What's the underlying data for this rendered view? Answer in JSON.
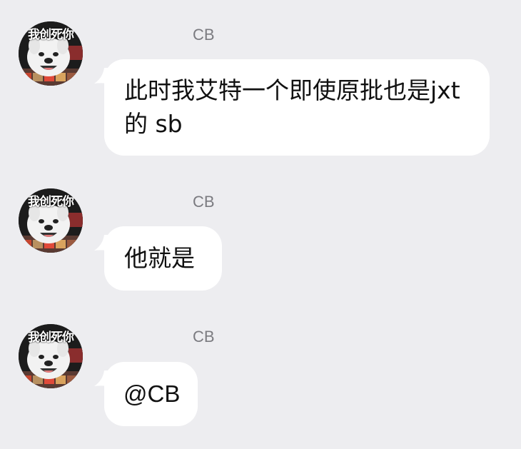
{
  "messages": [
    {
      "sender": "CB",
      "avatar_caption": "我创死你",
      "text": "此时我艾特一个即使原批也是jxt的 sb"
    },
    {
      "sender": "CB",
      "avatar_caption": "我创死你",
      "text": "他就是"
    },
    {
      "sender": "CB",
      "avatar_caption": "我创死你",
      "text": "@CB"
    }
  ],
  "colors": {
    "background": "#ededf0",
    "bubble": "#ffffff",
    "sender_name": "#7b7b80"
  }
}
